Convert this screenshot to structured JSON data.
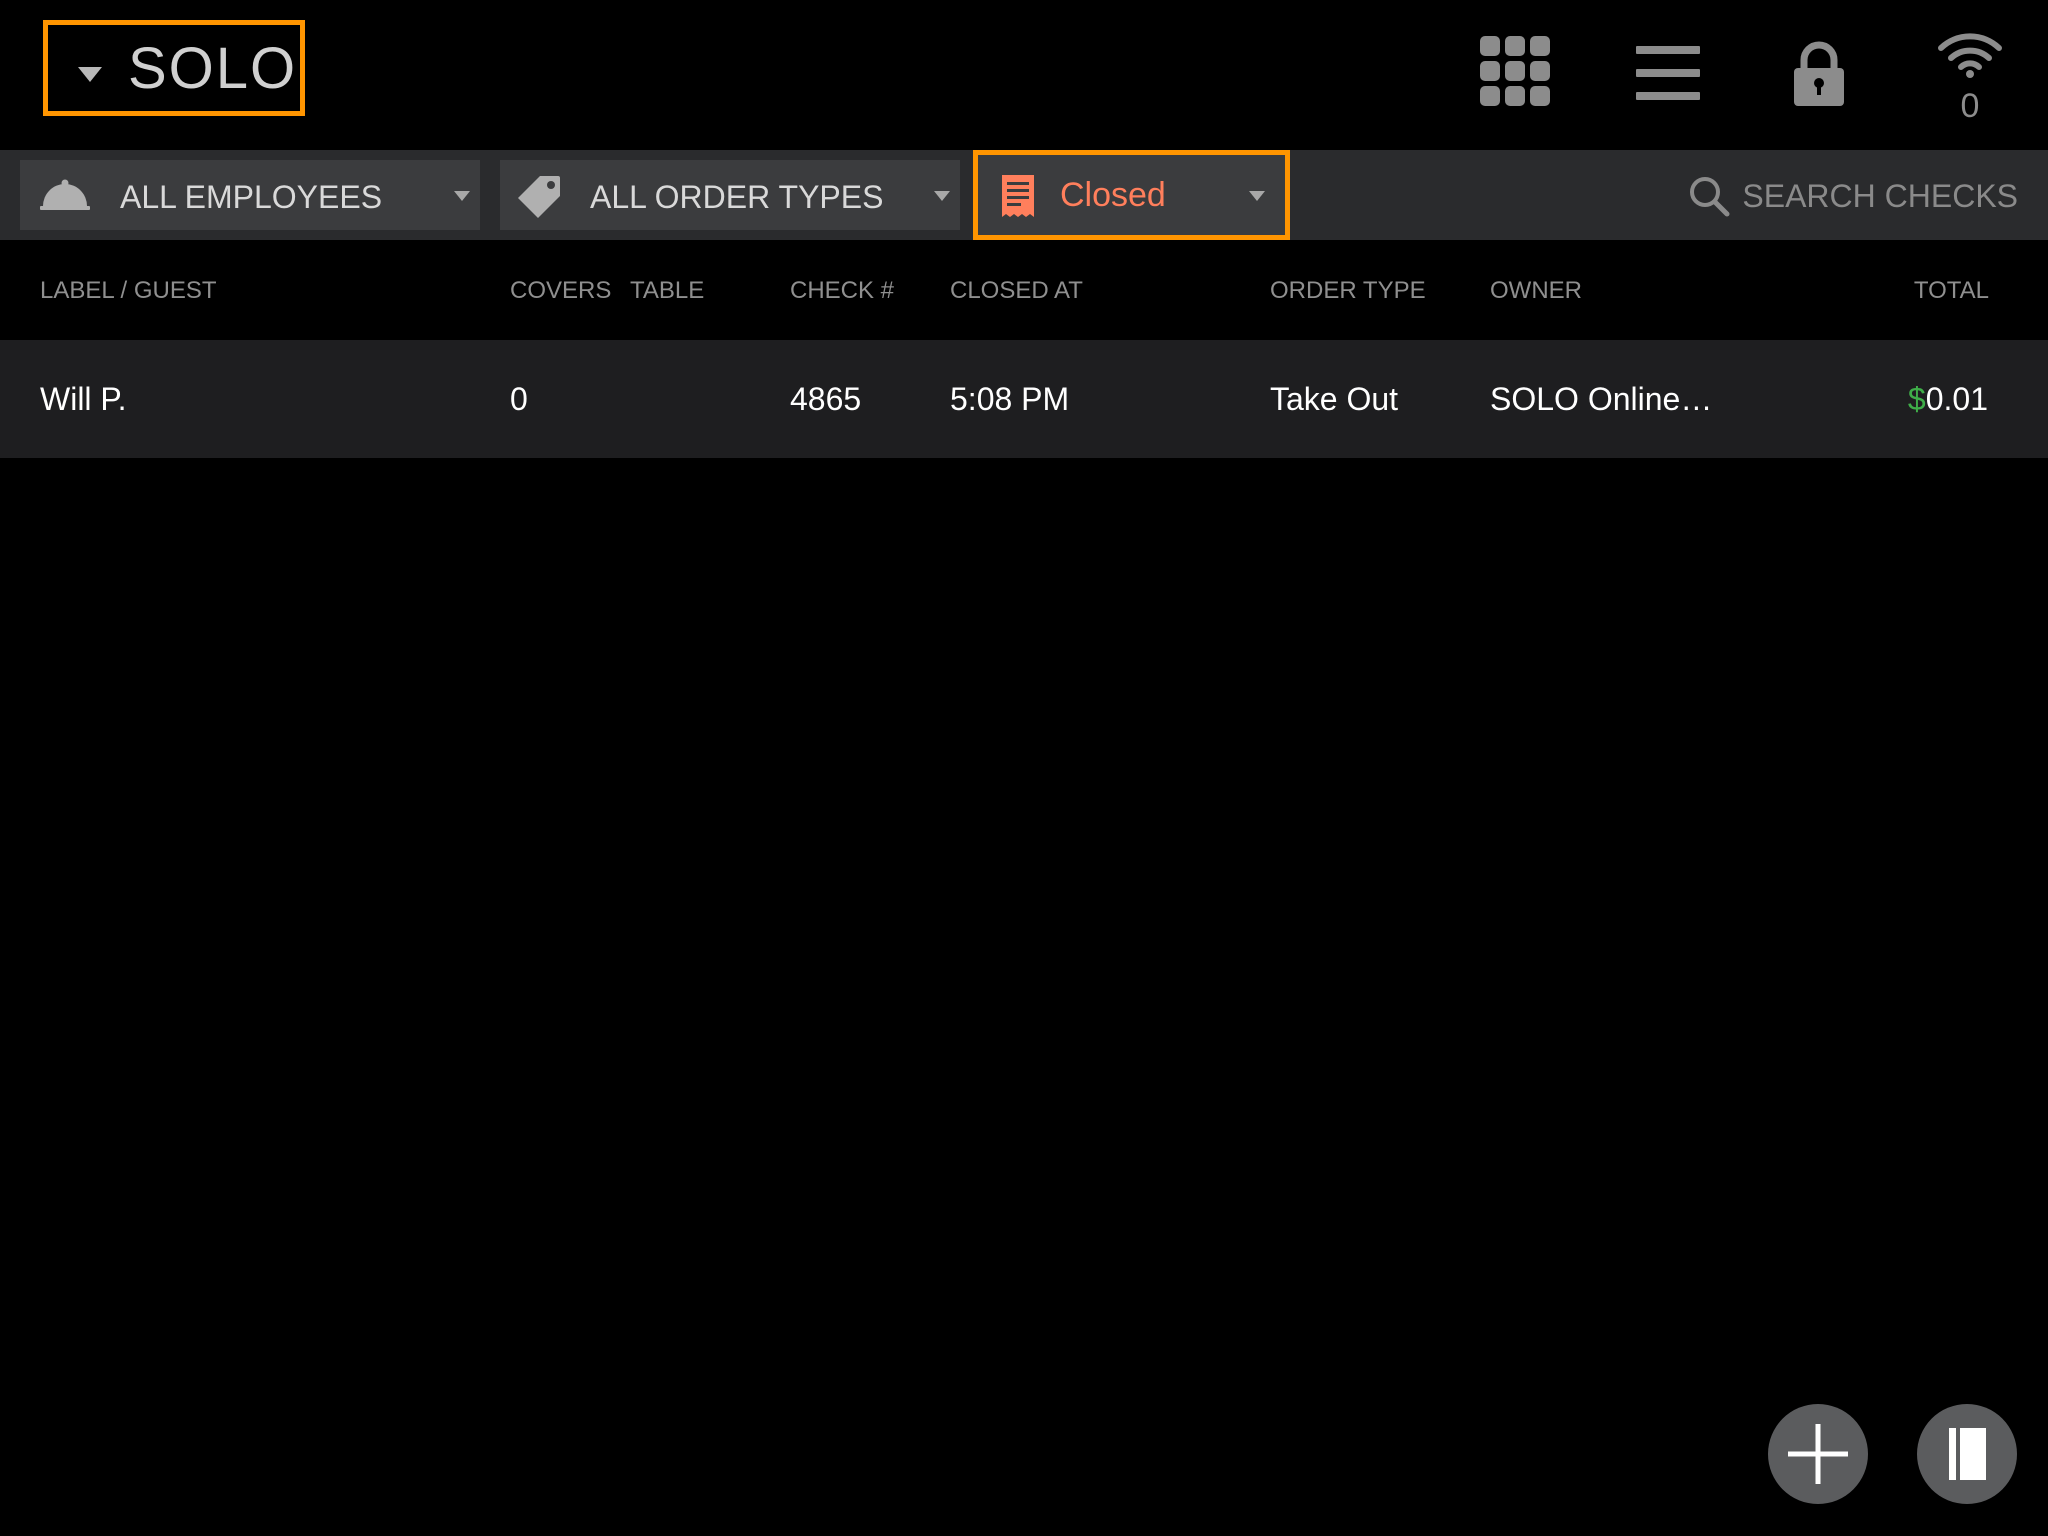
{
  "header": {
    "location_name": "SOLO",
    "wifi_count": "0",
    "icons": [
      "grid-icon",
      "menu-icon",
      "lock-icon",
      "wifi-icon"
    ]
  },
  "filters": {
    "employees_label": "ALL EMPLOYEES",
    "order_types_label": "ALL ORDER TYPES",
    "status_label": "Closed",
    "search_label": "SEARCH CHECKS"
  },
  "table": {
    "columns": {
      "label_guest": "LABEL / GUEST",
      "covers": "COVERS",
      "table": "TABLE",
      "check_no": "CHECK #",
      "closed_at": "CLOSED AT",
      "order_type": "ORDER TYPE",
      "owner": "OWNER",
      "total": "TOTAL"
    },
    "rows": [
      {
        "label_guest": "Will P.",
        "covers": "0",
        "table": "",
        "check_no": "4865",
        "closed_at": "5:08 PM",
        "order_type": "Take Out",
        "owner": "SOLO Online…",
        "currency": "$",
        "total": "0.01"
      }
    ]
  },
  "colors": {
    "highlight": "#ff9500",
    "status_text": "#ff7f5c",
    "currency": "#3fae49"
  }
}
